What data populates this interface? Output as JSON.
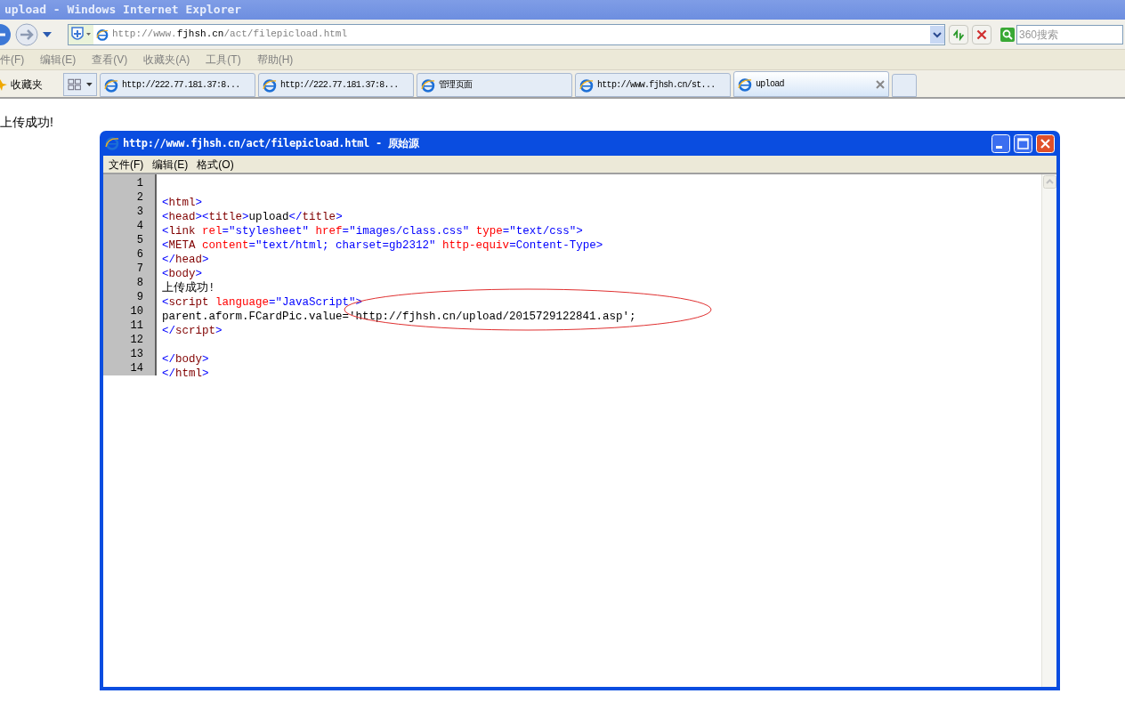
{
  "window": {
    "title": "upload - Windows Internet Explorer"
  },
  "address_bar": {
    "url_prefix": "http://www.",
    "url_domain": "fjhsh.cn",
    "url_path": "/act/filepicload.html"
  },
  "search": {
    "placeholder": "360搜索"
  },
  "menu": [
    "件(F)",
    "编辑(E)",
    "查看(V)",
    "收藏夹(A)",
    "工具(T)",
    "帮助(H)"
  ],
  "favorites": {
    "label": "收藏夹"
  },
  "tabs": [
    {
      "label": "http://222.77.181.37:8...",
      "selected": false
    },
    {
      "label": "http://222.77.181.37:8...",
      "selected": false
    },
    {
      "label": "管理页面",
      "selected": false
    },
    {
      "label": "http://www.fjhsh.cn/st...",
      "selected": false
    },
    {
      "label": "upload",
      "selected": true
    }
  ],
  "page_text": "上传成功!",
  "source_window": {
    "title": "http://www.fjhsh.cn/act/filepicload.html - 原始源",
    "menu": [
      "文件(F)",
      "编辑(E)",
      "格式(O)"
    ],
    "lines": [
      {
        "number": "1"
      },
      {
        "number": "2",
        "tokens": [
          {
            "kind": "punct",
            "text": "<"
          },
          {
            "kind": "tag",
            "text": "html"
          },
          {
            "kind": "punct",
            "text": ">"
          }
        ]
      },
      {
        "number": "3",
        "tokens": [
          {
            "kind": "punct",
            "text": "<"
          },
          {
            "kind": "tag",
            "text": "head"
          },
          {
            "kind": "punct",
            "text": "><"
          },
          {
            "kind": "tag",
            "text": "title"
          },
          {
            "kind": "punct",
            "text": ">"
          },
          {
            "kind": "text",
            "text": "upload"
          },
          {
            "kind": "punct",
            "text": "</"
          },
          {
            "kind": "tag",
            "text": "title"
          },
          {
            "kind": "punct",
            "text": ">"
          }
        ]
      },
      {
        "number": "4",
        "tokens": [
          {
            "kind": "punct",
            "text": "<"
          },
          {
            "kind": "tag",
            "text": "link "
          },
          {
            "kind": "attr",
            "text": "rel"
          },
          {
            "kind": "punct",
            "text": "="
          },
          {
            "kind": "value",
            "text": "\"stylesheet\" "
          },
          {
            "kind": "attr",
            "text": "href"
          },
          {
            "kind": "punct",
            "text": "="
          },
          {
            "kind": "value",
            "text": "\"images/class.css\" "
          },
          {
            "kind": "attr",
            "text": "type"
          },
          {
            "kind": "punct",
            "text": "="
          },
          {
            "kind": "value",
            "text": "\"text/css\""
          },
          {
            "kind": "punct",
            "text": ">"
          }
        ]
      },
      {
        "number": "5",
        "tokens": [
          {
            "kind": "punct",
            "text": "<"
          },
          {
            "kind": "tag",
            "text": "META "
          },
          {
            "kind": "attr",
            "text": "content"
          },
          {
            "kind": "punct",
            "text": "="
          },
          {
            "kind": "value",
            "text": "\"text/html; charset=gb2312\" "
          },
          {
            "kind": "attr",
            "text": "http-equiv"
          },
          {
            "kind": "punct",
            "text": "="
          },
          {
            "kind": "value",
            "text": "Content-Type"
          },
          {
            "kind": "punct",
            "text": ">"
          }
        ]
      },
      {
        "number": "6",
        "tokens": [
          {
            "kind": "punct",
            "text": "</"
          },
          {
            "kind": "tag",
            "text": "head"
          },
          {
            "kind": "punct",
            "text": ">"
          }
        ]
      },
      {
        "number": "7",
        "tokens": [
          {
            "kind": "punct",
            "text": "<"
          },
          {
            "kind": "tag",
            "text": "body"
          },
          {
            "kind": "punct",
            "text": ">"
          }
        ]
      },
      {
        "number": "8",
        "tokens": [
          {
            "kind": "text",
            "text": "上传成功!"
          }
        ]
      },
      {
        "number": "9",
        "tokens": [
          {
            "kind": "punct",
            "text": "<"
          },
          {
            "kind": "tag",
            "text": "script "
          },
          {
            "kind": "attr",
            "text": "language"
          },
          {
            "kind": "punct",
            "text": "="
          },
          {
            "kind": "value",
            "text": "\"JavaScript\""
          },
          {
            "kind": "punct",
            "text": ">"
          }
        ]
      },
      {
        "number": "10",
        "tokens": [
          {
            "kind": "text",
            "text": "parent.aform.FCardPic.value='http://fjhsh.cn/upload/2015729122841.asp';"
          }
        ]
      },
      {
        "number": "11",
        "tokens": [
          {
            "kind": "punct",
            "text": "</"
          },
          {
            "kind": "tag",
            "text": "script"
          },
          {
            "kind": "punct",
            "text": ">"
          }
        ]
      },
      {
        "number": "12"
      },
      {
        "number": "13",
        "tokens": [
          {
            "kind": "punct",
            "text": "</"
          },
          {
            "kind": "tag",
            "text": "body"
          },
          {
            "kind": "punct",
            "text": ">"
          }
        ]
      },
      {
        "number": "14",
        "tokens": [
          {
            "kind": "punct",
            "text": "</"
          },
          {
            "kind": "tag",
            "text": "html"
          },
          {
            "kind": "punct",
            "text": ">"
          }
        ]
      }
    ]
  }
}
